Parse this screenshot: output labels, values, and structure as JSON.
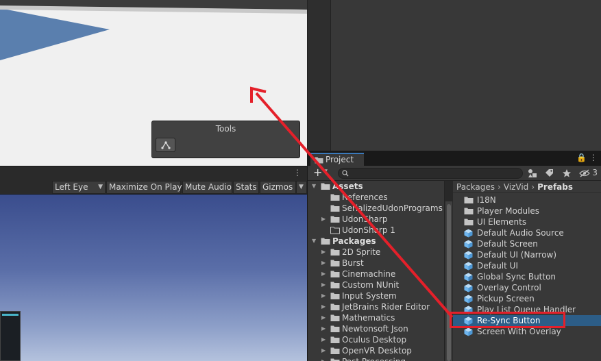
{
  "scene": {
    "tools_title": "Tools"
  },
  "game": {
    "menu_glyph": "⋮",
    "toolbar": {
      "display": "Left Eye",
      "maximize": "Maximize On Play",
      "mute": "Mute Audio",
      "stats": "Stats",
      "gizmos": "Gizmos"
    }
  },
  "project": {
    "tab_label": "Project",
    "tab_tools": "🔒 ⋮",
    "add_label": "+",
    "search_placeholder": "",
    "hidden_count": "3",
    "tree": [
      {
        "label": "Assets",
        "bold": true,
        "expanded": true,
        "indent": 0
      },
      {
        "label": "References",
        "bold": false,
        "expanded": null,
        "indent": 1
      },
      {
        "label": "SerializedUdonPrograms",
        "bold": false,
        "expanded": null,
        "indent": 1
      },
      {
        "label": "UdonSharp",
        "bold": false,
        "expanded": false,
        "indent": 1
      },
      {
        "label": "UdonSharp 1",
        "bold": false,
        "expanded": null,
        "indent": 1,
        "outline": true
      },
      {
        "label": "Packages",
        "bold": true,
        "expanded": true,
        "indent": 0
      },
      {
        "label": "2D Sprite",
        "bold": false,
        "expanded": false,
        "indent": 1
      },
      {
        "label": "Burst",
        "bold": false,
        "expanded": false,
        "indent": 1
      },
      {
        "label": "Cinemachine",
        "bold": false,
        "expanded": false,
        "indent": 1
      },
      {
        "label": "Custom NUnit",
        "bold": false,
        "expanded": false,
        "indent": 1
      },
      {
        "label": "Input System",
        "bold": false,
        "expanded": false,
        "indent": 1
      },
      {
        "label": "JetBrains Rider Editor",
        "bold": false,
        "expanded": false,
        "indent": 1
      },
      {
        "label": "Mathematics",
        "bold": false,
        "expanded": false,
        "indent": 1
      },
      {
        "label": "Newtonsoft Json",
        "bold": false,
        "expanded": false,
        "indent": 1
      },
      {
        "label": "Oculus Desktop",
        "bold": false,
        "expanded": false,
        "indent": 1
      },
      {
        "label": "OpenVR Desktop",
        "bold": false,
        "expanded": false,
        "indent": 1
      },
      {
        "label": "Post Processing",
        "bold": false,
        "expanded": false,
        "indent": 1
      }
    ],
    "breadcrumb": [
      "Packages",
      "VizVid",
      "Prefabs"
    ],
    "breadcrumb_sep": "›",
    "items": [
      {
        "label": "I18N",
        "kind": "folder",
        "selected": false
      },
      {
        "label": "Player Modules",
        "kind": "folder",
        "selected": false
      },
      {
        "label": "UI Elements",
        "kind": "folder",
        "selected": false
      },
      {
        "label": "Default Audio Source",
        "kind": "prefab",
        "selected": false
      },
      {
        "label": "Default Screen",
        "kind": "prefab",
        "selected": false
      },
      {
        "label": "Default UI (Narrow)",
        "kind": "prefab",
        "selected": false
      },
      {
        "label": "Default UI",
        "kind": "prefab",
        "selected": false
      },
      {
        "label": "Global Sync Button",
        "kind": "prefab-variant",
        "selected": false
      },
      {
        "label": "Overlay Control",
        "kind": "prefab",
        "selected": false
      },
      {
        "label": "Pickup Screen",
        "kind": "prefab",
        "selected": false
      },
      {
        "label": "Play List Queue Handler",
        "kind": "prefab",
        "selected": false
      },
      {
        "label": "Re-Sync Button",
        "kind": "prefab",
        "selected": true
      },
      {
        "label": "Screen With Overlay",
        "kind": "prefab",
        "selected": false
      }
    ]
  },
  "colors": {
    "annotation": "#e4202a",
    "selection": "#2c5d87",
    "prefab_icon": "#6fb6ef"
  },
  "icons": [
    "tool-handle-icon",
    "folder-icon",
    "prefab-icon",
    "search-icon",
    "filter-type-icon",
    "label-icon",
    "star-icon",
    "eye-hidden-icon",
    "lock-icon",
    "kebab-menu-icon"
  ]
}
